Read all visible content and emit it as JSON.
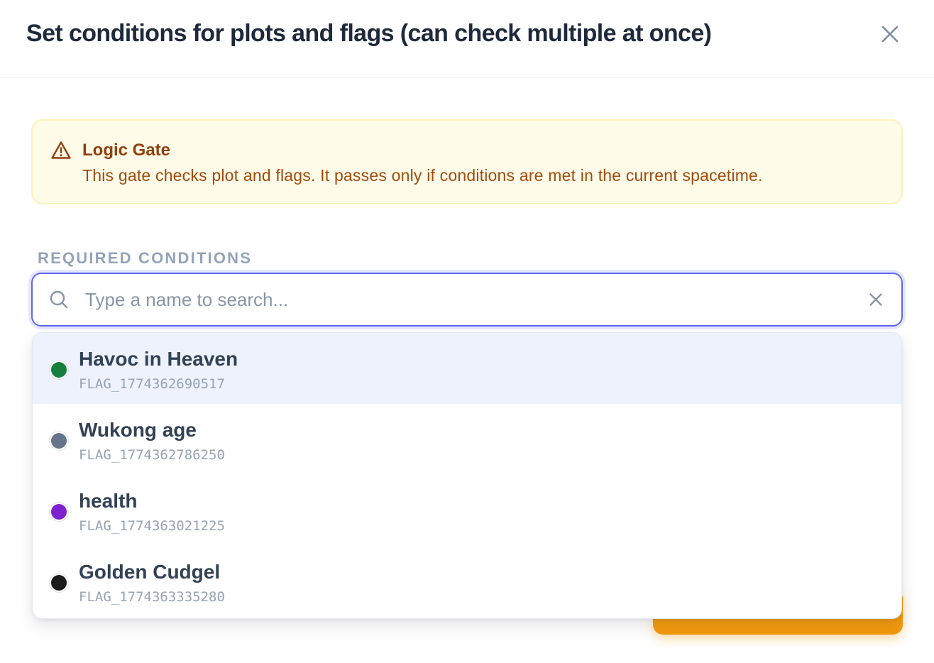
{
  "dialog": {
    "title": "Set conditions for plots and flags (can check multiple at once)",
    "close_icon": "close-icon"
  },
  "alert": {
    "icon": "warning-triangle-icon",
    "title": "Logic Gate",
    "text": "This gate checks plot and flags. It passes only if conditions are met in the current spacetime."
  },
  "section": {
    "label": "REQUIRED CONDITIONS"
  },
  "search": {
    "placeholder": "Type a name to search...",
    "value": "",
    "icon": "search-icon",
    "clear_icon": "clear-icon"
  },
  "options": [
    {
      "name": "Havoc in Heaven",
      "id": "FLAG_1774362690517",
      "color": "#15803d",
      "highlighted": true
    },
    {
      "name": "Wukong age",
      "id": "FLAG_1774362786250",
      "color": "#64748b",
      "highlighted": false
    },
    {
      "name": "health",
      "id": "FLAG_1774363021225",
      "color": "#7e22ce",
      "highlighted": false
    },
    {
      "name": "Golden Cudgel",
      "id": "FLAG_1774363335280",
      "color": "#1c1c1c",
      "highlighted": false
    }
  ],
  "colors": {
    "accent": "#6366f1",
    "primary_button": "#f29a0d",
    "alert_bg": "#fefbe8",
    "alert_text": "#92400e"
  }
}
